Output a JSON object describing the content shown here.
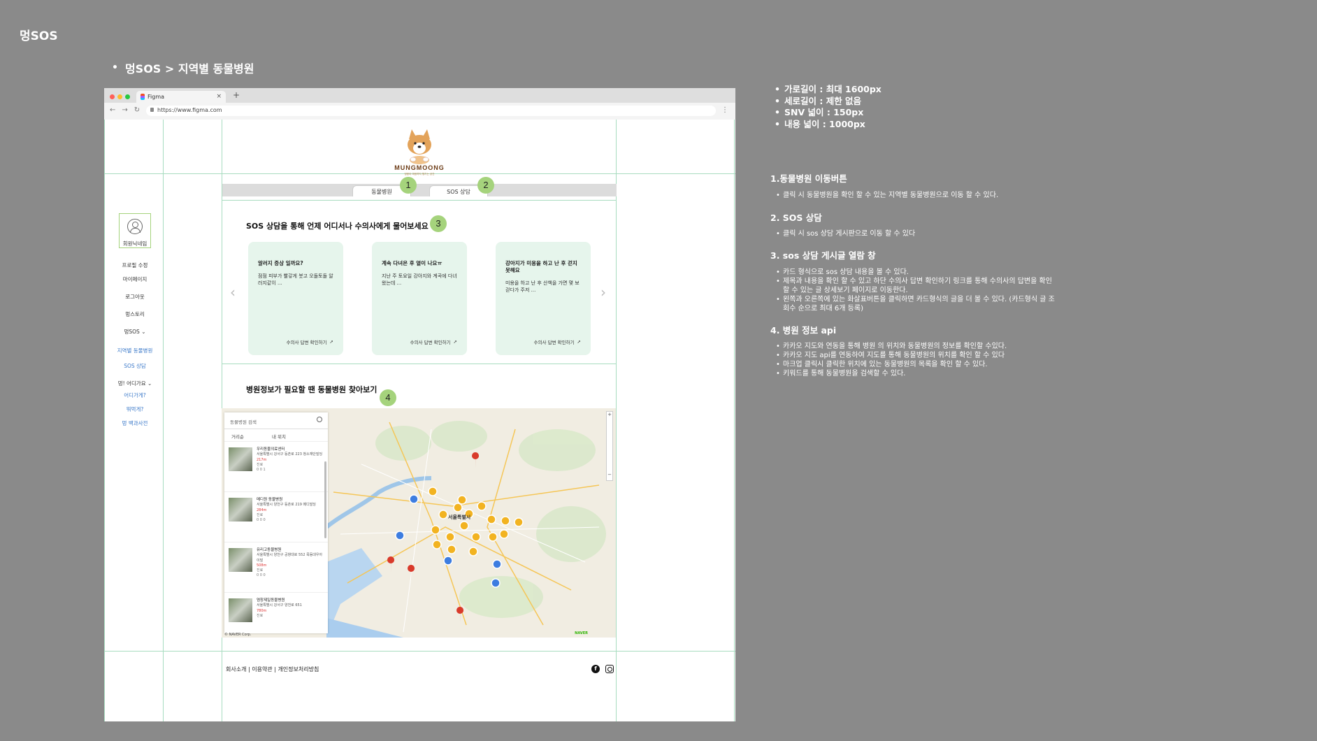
{
  "page": {
    "title": "멍SOS",
    "section": "멍SOS > 지역별 동물병원"
  },
  "browser": {
    "tab_title": "Figma",
    "url": "https://www.figma.com"
  },
  "site": {
    "logo_text": "MUNGMOONG",
    "logo_tagline": "멍뭉이 마음까지 챙기는 공간",
    "nav": {
      "hospital_label": "동물병원",
      "sos_label": "SOS 상담"
    },
    "sidebar": {
      "profile_name": "회원닉네임",
      "items": [
        {
          "label": "프로필 수정"
        },
        {
          "label": "마이페이지"
        },
        {
          "label": "로그아웃"
        },
        {
          "label": "멍스토리"
        },
        {
          "label": "멍SOS"
        },
        {
          "label": "지역별 동물병원"
        },
        {
          "label": "SOS 상담"
        },
        {
          "label": "멍! 어디가요"
        },
        {
          "label": "어디가게?"
        },
        {
          "label": "뭐먹게?"
        },
        {
          "label": "멍 백과사전"
        }
      ]
    },
    "sos": {
      "heading": "SOS 상담을 통해 언제 어디서나 수의사에게 물어보세요",
      "cards": [
        {
          "title": "알러지 증상 일까요?",
          "body": "점점 피부가 빨갛게 붓고 오돌토돌 알러지같이 ...",
          "link": "수의사 답변 확인하기"
        },
        {
          "title": "계속 다녀온 후 열이 나요ㅠ",
          "body": "지난 주 토요일 강아지와 계곡에 다녀왔는데 ...",
          "link": "수의사 답변 확인하기"
        },
        {
          "title": "강아지가 미용을 하고 난 후 걷지 못해요",
          "body": "미용을 하고 난 후 산책을 가면 몇 보 걷다가 주저 ...",
          "link": "수의사 답변 확인하기"
        }
      ]
    },
    "hospital": {
      "heading": "병원정보가 필요할 땐 동물병원 찾아보기",
      "search_placeholder": "동물병원 검색",
      "filter_sort": "거리순",
      "filter_location": "내 위치",
      "places": [
        {
          "name": "우리동물의료센터",
          "addr": "서울특별시 강서구 등촌로 223 청소재단빌딩",
          "dist": "217m",
          "status": "진료",
          "meta": "0   0   1"
        },
        {
          "name": "메디원 동물병원",
          "addr": "서울특별시 양천구 등촌로 219 메디빌딩",
          "dist": "284m",
          "status": "진료",
          "meta": "0   0   0"
        },
        {
          "name": "유리고동물병원",
          "addr": "서울특별시 양천구 공항대로 552 목동대우아이빌",
          "dist": "508m",
          "status": "진료",
          "meta": "0   0   0"
        },
        {
          "name": "염창제일동물병원",
          "addr": "서울특별시 강서구 양천로 651",
          "dist": "780m",
          "status": "진료",
          "meta": ""
        }
      ],
      "map_label": "서울특별시",
      "naver": "NAVER",
      "copyright": "© NAVER Corp."
    },
    "footer": {
      "links": "회사소개 | 이용약관 | 개인정보처리방침"
    }
  },
  "markers": [
    "1",
    "2",
    "3",
    "4"
  ],
  "specs": [
    "가로길이 : 최대 1600px",
    "세로길이 : 제한 없음",
    "SNV 넓이 :  150px",
    "내용 넓이 : 1000px"
  ],
  "notes": [
    {
      "heading": "1.동물병원  이동버튼",
      "items": [
        "클릭 시 동물병원을 확인 할 수 있는 지역별 동물병원으로 이동 할 수 있다."
      ]
    },
    {
      "heading": "2. SOS 상담",
      "items": [
        "클릭 시 sos 상담 게시판으로 이동 할 수 있다"
      ]
    },
    {
      "heading": "3. sos 상담 게시글 열람 창",
      "items": [
        "카드 형식으로 sos 상담 내용을 볼 수 있다.",
        "제목과 내용을 확인 할 수 있고 하단 수의사 답변 확인하기 링크를 통해 수의사의 답변을 확인 할 수 있는 글 상세보기 페이지로 이동한다.",
        "왼쪽과 오른쪽에 있는 화살표버튼을 클릭하면 카드형식의 글을 더 볼 수 있다. (카드형식 글 조회수 순으로 최대 6개 등록)"
      ]
    },
    {
      "heading": "4. 병원 정보 api",
      "items": [
        "카카오 지도와 연동을 통해 병원 의 위치와 동물병원의 정보를 확인할 수있다.",
        "카카오 지도 api를 연동하여 지도를 통해 동물병원의 위치를 확인 할 수 있다",
        "마크업 클릭시 클릭한 위치에 있는 동물병원의 목록을 확인 할 수 있다.",
        "키워드를 통해 동물병원을 검색할 수 있다."
      ]
    }
  ],
  "colors": {
    "background": "#8a8a8a",
    "marker": "#a5d37c",
    "card": "#e6f5ec",
    "guide": "#a8dcc0"
  }
}
